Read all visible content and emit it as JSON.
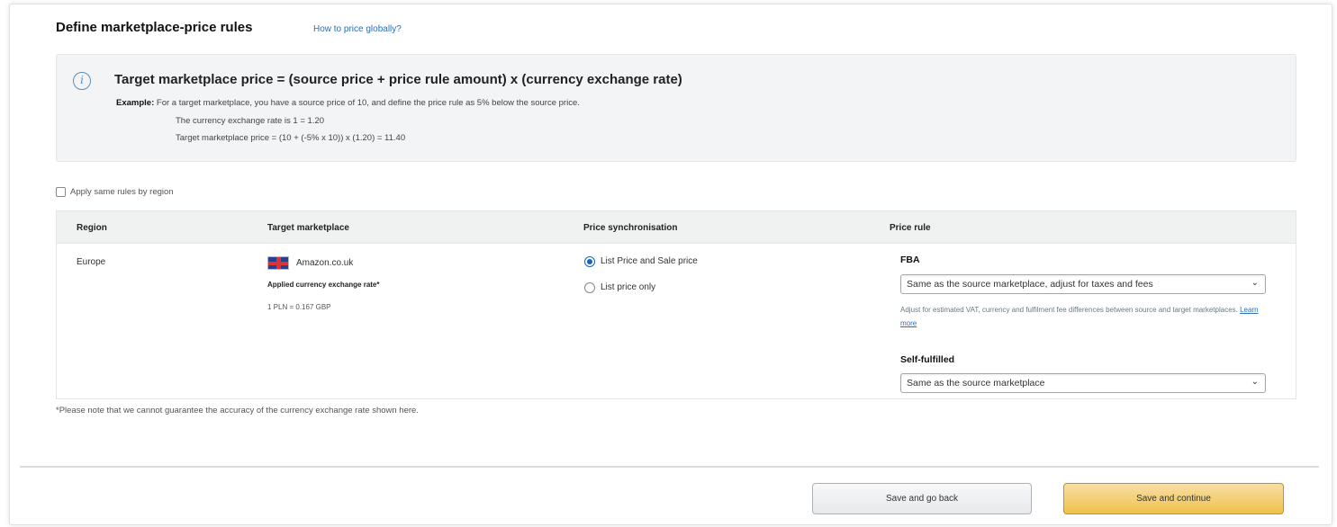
{
  "header": {
    "title": "Define marketplace-price rules",
    "help_link": "How to price globally?"
  },
  "info": {
    "formula": "Target marketplace price = (source price + price rule amount) x (currency exchange rate)",
    "example_label": "Example:",
    "example_text": "For a target marketplace, you have a source price of 10, and define the price rule as 5% below the source price.",
    "exchange_line": "The currency exchange rate is 1 = 1.20",
    "calc_line": "Target marketplace price = (10 + (-5% x 10)) x (1.20) = 11.40"
  },
  "apply_same_rules": {
    "label": "Apply same rules by region",
    "checked": false
  },
  "table": {
    "columns": [
      "Region",
      "Target marketplace",
      "Price synchronisation",
      "Price rule"
    ],
    "row": {
      "region": "Europe",
      "marketplace": "Amazon.co.uk",
      "rate_label": "Applied currency exchange rate*",
      "rate_value": "1 PLN = 0.167 GBP",
      "sync_options": [
        "List Price and Sale price",
        "List price only"
      ],
      "sync_selected": "List Price and Sale price",
      "fba_label": "FBA",
      "fba_value": "Same as the source marketplace, adjust for taxes and fees",
      "fba_helper": "Adjust for estimated VAT, currency and fulfilment fee differences between source and target marketplaces.",
      "learn_more": "Learn more",
      "self_label": "Self-fulfilled",
      "self_value": "Same as the source marketplace"
    }
  },
  "footnote": "*Please note that we cannot guarantee the accuracy of the currency exchange rate shown here.",
  "buttons": {
    "back": "Save and go back",
    "continue": "Save and continue"
  },
  "colors": {
    "link": "#2a6fb5",
    "primary_button": "#f0c14b",
    "radio_selected": "#1565c0"
  }
}
